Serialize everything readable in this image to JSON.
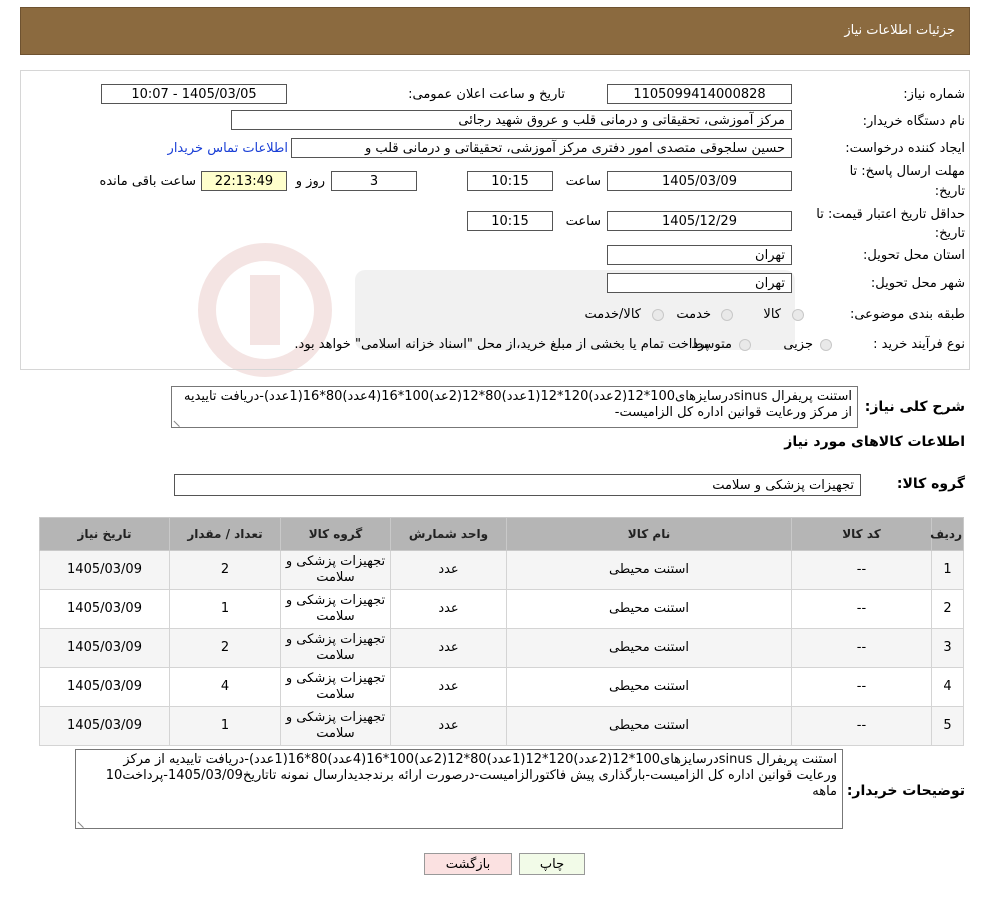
{
  "header": {
    "title": "جزئیات اطلاعات نیاز"
  },
  "form": {
    "need_number_label": "شماره نیاز:",
    "need_number": "1105099414000828",
    "announce_label": "تاریخ و ساعت اعلان عمومی:",
    "announce_value": "1405/03/05 - 10:07",
    "buyer_org_label": "نام دستگاه خریدار:",
    "buyer_org": "مرکز آموزشی، تحقیقاتی و درمانی قلب و عروق شهید رجائی",
    "requester_label": "ایجاد کننده درخواست:",
    "requester": "حسین سلجوقی متصدی امور دفتری مرکز آموزشی، تحقیقاتی و درمانی قلب و",
    "contact_link": "اطلاعات تماس خریدار",
    "deadline_label_1": "مهلت ارسال پاسخ: تا",
    "deadline_label_2": "تاریخ:",
    "deadline_date": "1405/03/09",
    "time_label": "ساعت",
    "deadline_time": "10:15",
    "days": "3",
    "days_label": "روز و",
    "remaining_time": "22:13:49",
    "remaining_label": "ساعت باقی مانده",
    "validity_label_1": "حداقل تاریخ اعتبار قیمت: تا",
    "validity_label_2": "تاریخ:",
    "validity_date": "1405/12/29",
    "validity_time": "10:15",
    "province_label": "استان محل تحویل:",
    "province": "تهران",
    "city_label": "شهر محل تحویل:",
    "city": "تهران",
    "category_label": "طبقه بندی موضوعی:",
    "category_options": [
      "کالا",
      "خدمت",
      "کالا/خدمت"
    ],
    "process_label": "نوع فرآیند خرید :",
    "process_options": [
      "جزیی",
      "متوسط"
    ],
    "process_note": "پرداخت تمام یا بخشی از مبلغ خرید،از محل \"اسناد خزانه اسلامی\" خواهد بود."
  },
  "summary": {
    "label": "شرح کلی نیاز:",
    "text": "استنت پریفرال sinusدرسایزهای100*12(2عدد)120*12(1عدد)80*12(2عد)100*16(4عدد)80*16(1عدد)-دریافت تاییدیه از مرکز ورعایت قوانین اداره کل الزامیست-"
  },
  "goods": {
    "section_title": "اطلاعات کالاهای مورد نیاز",
    "group_label": "گروه کالا:",
    "group_value": "تجهیزات پزشکی و سلامت"
  },
  "table": {
    "headers": [
      "ردیف",
      "کد کالا",
      "نام کالا",
      "واحد شمارش",
      "گروه کالا",
      "تعداد / مقدار",
      "تاریخ نیاز"
    ],
    "rows": [
      [
        "1",
        "--",
        "استنت محیطی",
        "عدد",
        "تجهیزات پزشکی و سلامت",
        "2",
        "1405/03/09"
      ],
      [
        "2",
        "--",
        "استنت محیطی",
        "عدد",
        "تجهیزات پزشکی و سلامت",
        "1",
        "1405/03/09"
      ],
      [
        "3",
        "--",
        "استنت محیطی",
        "عدد",
        "تجهیزات پزشکی و سلامت",
        "2",
        "1405/03/09"
      ],
      [
        "4",
        "--",
        "استنت محیطی",
        "عدد",
        "تجهیزات پزشکی و سلامت",
        "4",
        "1405/03/09"
      ],
      [
        "5",
        "--",
        "استنت محیطی",
        "عدد",
        "تجهیزات پزشکی و سلامت",
        "1",
        "1405/03/09"
      ]
    ]
  },
  "buyer_notes": {
    "label": "توضیحات خریدار:",
    "text": "استنت پریفرال sinusدرسایزهای100*12(2عدد)120*12(1عدد)80*12(2عد)100*16(4عدد)80*16(1عدد)-دریافت تاییدیه از مرکز ورعایت قوانین اداره کل الزامیست-بارگذاری پیش فاکتورالزامیست-درصورت ارائه برندجدیدارسال نمونه تاتاریخ1405/03/09-پرداخت10 ماهه"
  },
  "buttons": {
    "print": "چاپ",
    "back": "بازگشت"
  },
  "colors": {
    "header_bg": "#8b6a3f",
    "link": "#1a3fd6",
    "yellow_box": "#ffffcc",
    "table_header": "#b5b5b5"
  }
}
